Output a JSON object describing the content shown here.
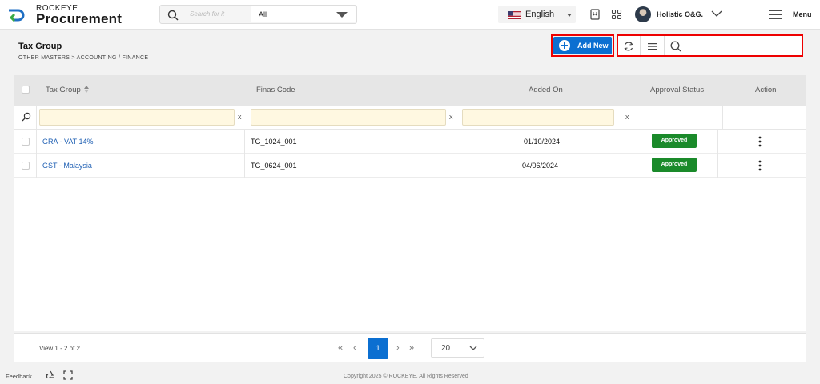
{
  "app": {
    "brand_small": "ROCKEYE",
    "brand_big": "Procurement",
    "search_placeholder": "Search for it",
    "search_scope": "All",
    "language": "English",
    "user_name": "Holistic O&G.",
    "menu_label": "Menu"
  },
  "page": {
    "title": "Tax Group",
    "breadcrumb": "OTHER MASTERS >  ACCOUNTING / FINANCE",
    "add_new_label": "Add New"
  },
  "table": {
    "columns": [
      "Tax Group",
      "Finas Code",
      "Added On",
      "Approval Status",
      "Action"
    ],
    "rows": [
      {
        "tax_group": "GRA - VAT 14%",
        "finas_code": "TG_1024_001",
        "added_on": "01/10/2024",
        "status": "Approved"
      },
      {
        "tax_group": "GST - Malaysia",
        "finas_code": "TG_0624_001",
        "added_on": "04/06/2024",
        "status": "Approved"
      }
    ],
    "filter_clear": "x"
  },
  "pager": {
    "view_info": "View 1 - 2 of 2",
    "current_page": "1",
    "page_size": "20",
    "first": "«",
    "prev": "‹",
    "next": "›",
    "last": "»"
  },
  "footer": {
    "feedback": "Feedback",
    "copyright": "Copyright 2025 © ROCKEYE. All Rights Reserved"
  },
  "colors": {
    "primary": "#0b6fd1",
    "approved": "#1a8a2a",
    "highlight_frame": "#ee0000",
    "filter_bg": "#fff8e1"
  }
}
